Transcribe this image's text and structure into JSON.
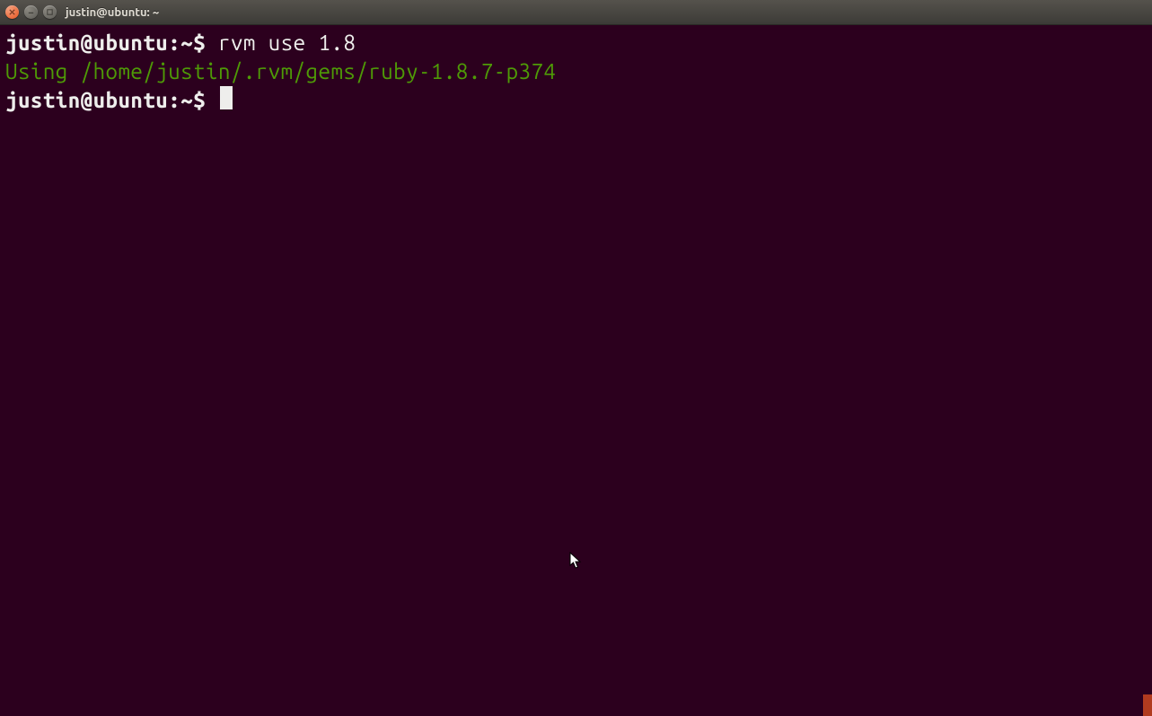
{
  "window": {
    "title": "justin@ubuntu: ~"
  },
  "terminal": {
    "lines": [
      {
        "prompt_user_host": "justin@ubuntu",
        "prompt_path": "~",
        "prompt_symbol": "$",
        "command": "rvm use 1.8"
      }
    ],
    "output": "Using /home/justin/.rvm/gems/ruby-1.8.7-p374",
    "current_prompt": {
      "user_host": "justin@ubuntu",
      "path": "~",
      "symbol": "$"
    }
  }
}
